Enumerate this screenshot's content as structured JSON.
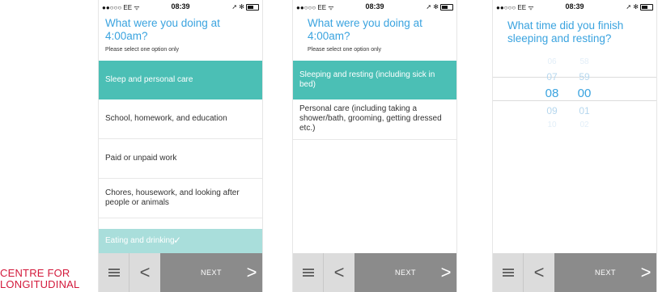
{
  "status": {
    "carrier": "●●○○○ EE ᯤ",
    "time": "08:39",
    "right": "➚ ✻"
  },
  "screen1": {
    "question": "What were you doing at 4:00am?",
    "hint": "Please select one option only",
    "options": [
      "Sleep and personal care",
      "School, homework, and education",
      "Paid or unpaid work",
      "Chores, housework, and looking after people or animals",
      "Eating and drinking"
    ],
    "check": "✓"
  },
  "screen2": {
    "question": "What were you doing at 4:00am?",
    "hint": "Please select one option only",
    "options": [
      "Sleeping and resting (including sick in bed)",
      "Personal care (including taking a shower/bath, grooming, getting dressed etc.)"
    ]
  },
  "screen3": {
    "question": "What time did you finish sleeping and resting?",
    "hours": [
      "06",
      "07",
      "08",
      "09",
      "10"
    ],
    "minutes": [
      "58",
      "59",
      "00",
      "01",
      "02"
    ]
  },
  "nav": {
    "next": "NEXT",
    "back_glyph": "<",
    "next_glyph": ">"
  },
  "logo": {
    "line1": "CENTRE FOR",
    "line2": "LONGITUDINAL"
  }
}
